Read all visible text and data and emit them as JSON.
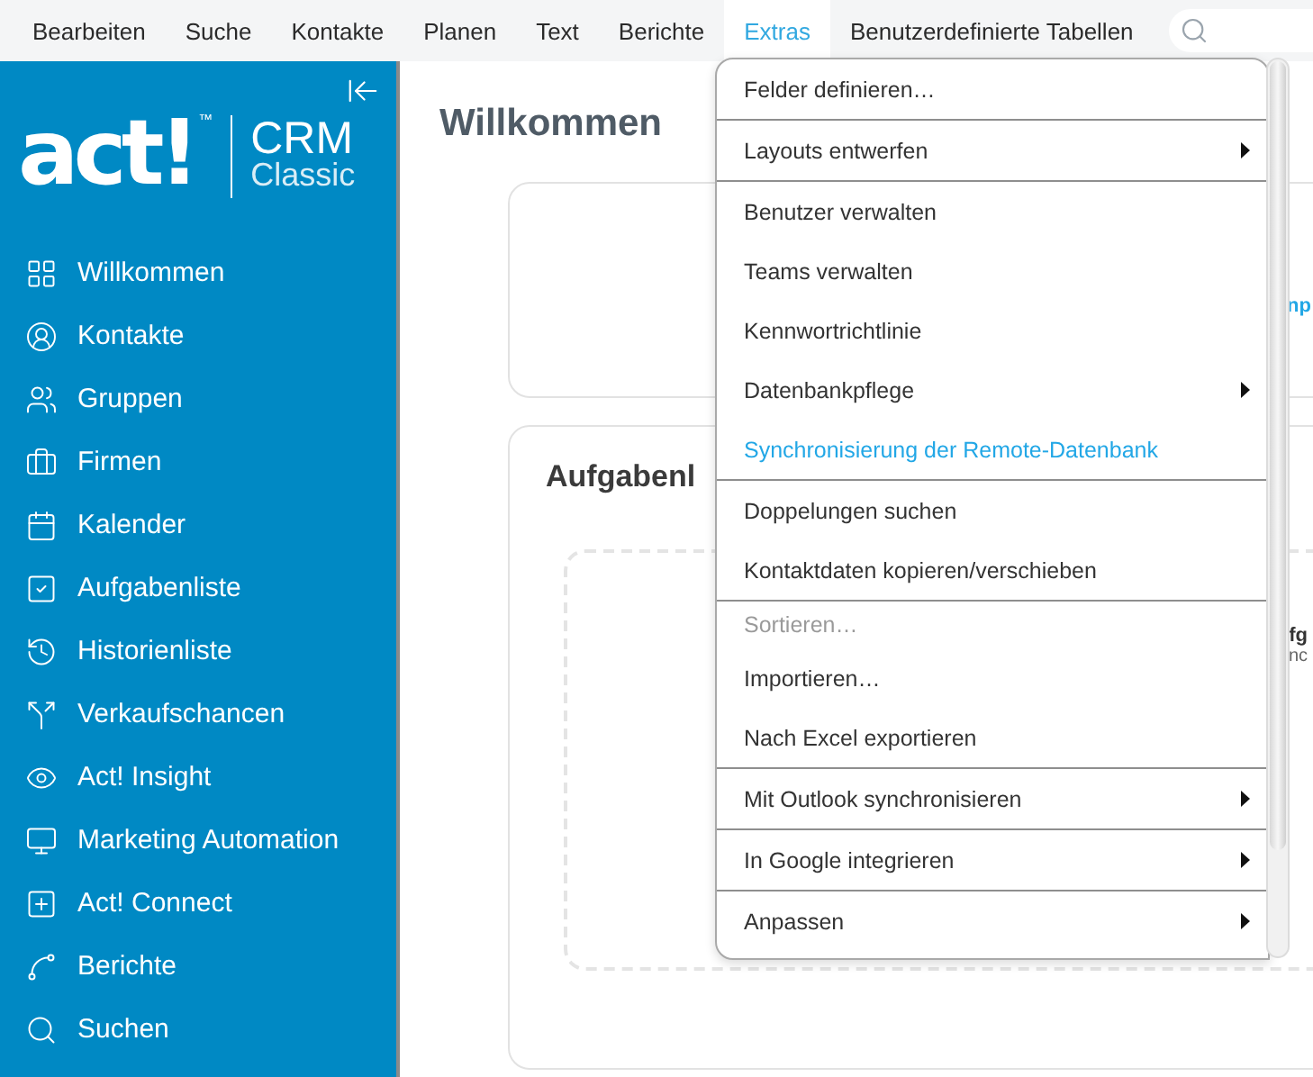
{
  "menubar": {
    "items": [
      {
        "label": "Bearbeiten",
        "selected": false
      },
      {
        "label": "Suche",
        "selected": false
      },
      {
        "label": "Kontakte",
        "selected": false
      },
      {
        "label": "Planen",
        "selected": false
      },
      {
        "label": "Text",
        "selected": false
      },
      {
        "label": "Berichte",
        "selected": false
      },
      {
        "label": "Extras",
        "selected": true
      },
      {
        "label": "Benutzerdefinierte Tabellen",
        "selected": false
      }
    ]
  },
  "sidebar": {
    "logo": {
      "wordmark": "act!",
      "trademark": "™",
      "product": "CRM",
      "edition": "Classic"
    },
    "items": [
      {
        "label": "Willkommen"
      },
      {
        "label": "Kontakte"
      },
      {
        "label": "Gruppen"
      },
      {
        "label": "Firmen"
      },
      {
        "label": "Kalender"
      },
      {
        "label": "Aufgabenliste"
      },
      {
        "label": "Historienliste"
      },
      {
        "label": "Verkaufschancen"
      },
      {
        "label": "Act! Insight"
      },
      {
        "label": "Marketing Automation"
      },
      {
        "label": "Act! Connect"
      },
      {
        "label": "Berichte"
      },
      {
        "label": "Suchen"
      }
    ]
  },
  "main": {
    "title": "Willkommen",
    "card_1": {
      "link": "np"
    },
    "card_2": {
      "heading": "Aufgabenl",
      "inner_title": "fg",
      "inner_text": "nc"
    }
  },
  "extras_menu": {
    "groups": [
      [
        {
          "label": "Felder definieren…",
          "submenu": false,
          "disabled": false,
          "highlighted": false
        }
      ],
      [
        {
          "label": "Layouts entwerfen",
          "submenu": true,
          "disabled": false,
          "highlighted": false
        }
      ],
      [
        {
          "label": "Benutzer verwalten",
          "submenu": false,
          "disabled": false,
          "highlighted": false
        },
        {
          "label": "Teams verwalten",
          "submenu": false,
          "disabled": false,
          "highlighted": false
        },
        {
          "label": "Kennwortrichtlinie",
          "submenu": false,
          "disabled": false,
          "highlighted": false
        },
        {
          "label": "Datenbankpflege",
          "submenu": true,
          "disabled": false,
          "highlighted": false
        },
        {
          "label": "Synchronisierung der Remote-Datenbank",
          "submenu": false,
          "disabled": false,
          "highlighted": true
        }
      ],
      [
        {
          "label": "Doppelungen suchen",
          "submenu": false,
          "disabled": false,
          "highlighted": false
        },
        {
          "label": "Kontaktdaten kopieren/verschieben",
          "submenu": false,
          "disabled": false,
          "highlighted": false
        }
      ],
      [
        {
          "label": "Sortieren…",
          "submenu": false,
          "disabled": true,
          "highlighted": false
        },
        {
          "label": "Importieren…",
          "submenu": false,
          "disabled": false,
          "highlighted": false
        },
        {
          "label": "Nach Excel exportieren",
          "submenu": false,
          "disabled": false,
          "highlighted": false
        }
      ],
      [
        {
          "label": "Mit Outlook synchronisieren",
          "submenu": true,
          "disabled": false,
          "highlighted": false
        }
      ],
      [
        {
          "label": "In Google integrieren",
          "submenu": true,
          "disabled": false,
          "highlighted": false
        }
      ],
      [
        {
          "label": "Anpassen",
          "submenu": true,
          "disabled": false,
          "highlighted": false
        }
      ]
    ]
  }
}
